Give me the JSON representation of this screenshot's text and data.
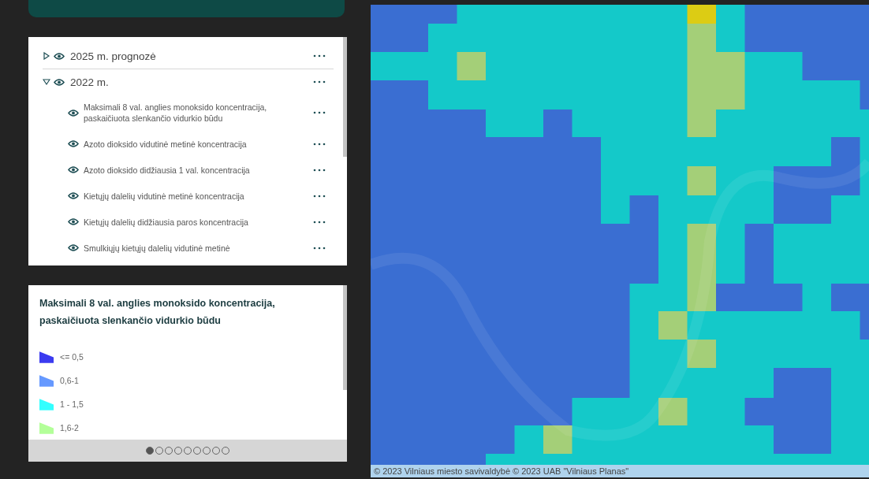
{
  "layers": [
    {
      "label": "2025 m. prognozė",
      "expanded": false
    },
    {
      "label": "2022 m.",
      "expanded": true,
      "children": [
        {
          "label": "Maksimali 8 val. anglies monoksido koncentracija, paskaičiuota slenkančio vidurkio būdu"
        },
        {
          "label": "Azoto dioksido vidutinė metinė koncentracija"
        },
        {
          "label": "Azoto dioksido didžiausia 1 val. koncentracija"
        },
        {
          "label": "Kietųjų dalelių vidutinė metinė koncentracija"
        },
        {
          "label": "Kietųjų dalelių didžiausia paros koncentracija"
        },
        {
          "label": "Smulkiųjų kietųjų dalelių vidutinė metinė"
        }
      ]
    }
  ],
  "legend": {
    "title": "Maksimali 8 val. anglies monoksido koncentracija, paskaičiuota slenkančio vidurkio būdu",
    "items": [
      {
        "label": "<= 0,5",
        "color": "#3b3bf0"
      },
      {
        "label": "0,6-1",
        "color": "#6699ff"
      },
      {
        "label": "1 - 1,5",
        "color": "#33ffff"
      },
      {
        "label": "1,6-2",
        "color": "#b3ff99"
      }
    ],
    "pager": [
      {
        "selected": true
      },
      {
        "selected": false
      },
      {
        "selected": false
      },
      {
        "selected": false
      },
      {
        "selected": false
      },
      {
        "selected": false
      },
      {
        "selected": false
      },
      {
        "selected": false
      },
      {
        "selected": false
      }
    ]
  },
  "map": {
    "attribution": "© 2023 Vilniaus miesto savivaldybė © 2023 UAB \"Vilniaus Planas\""
  }
}
